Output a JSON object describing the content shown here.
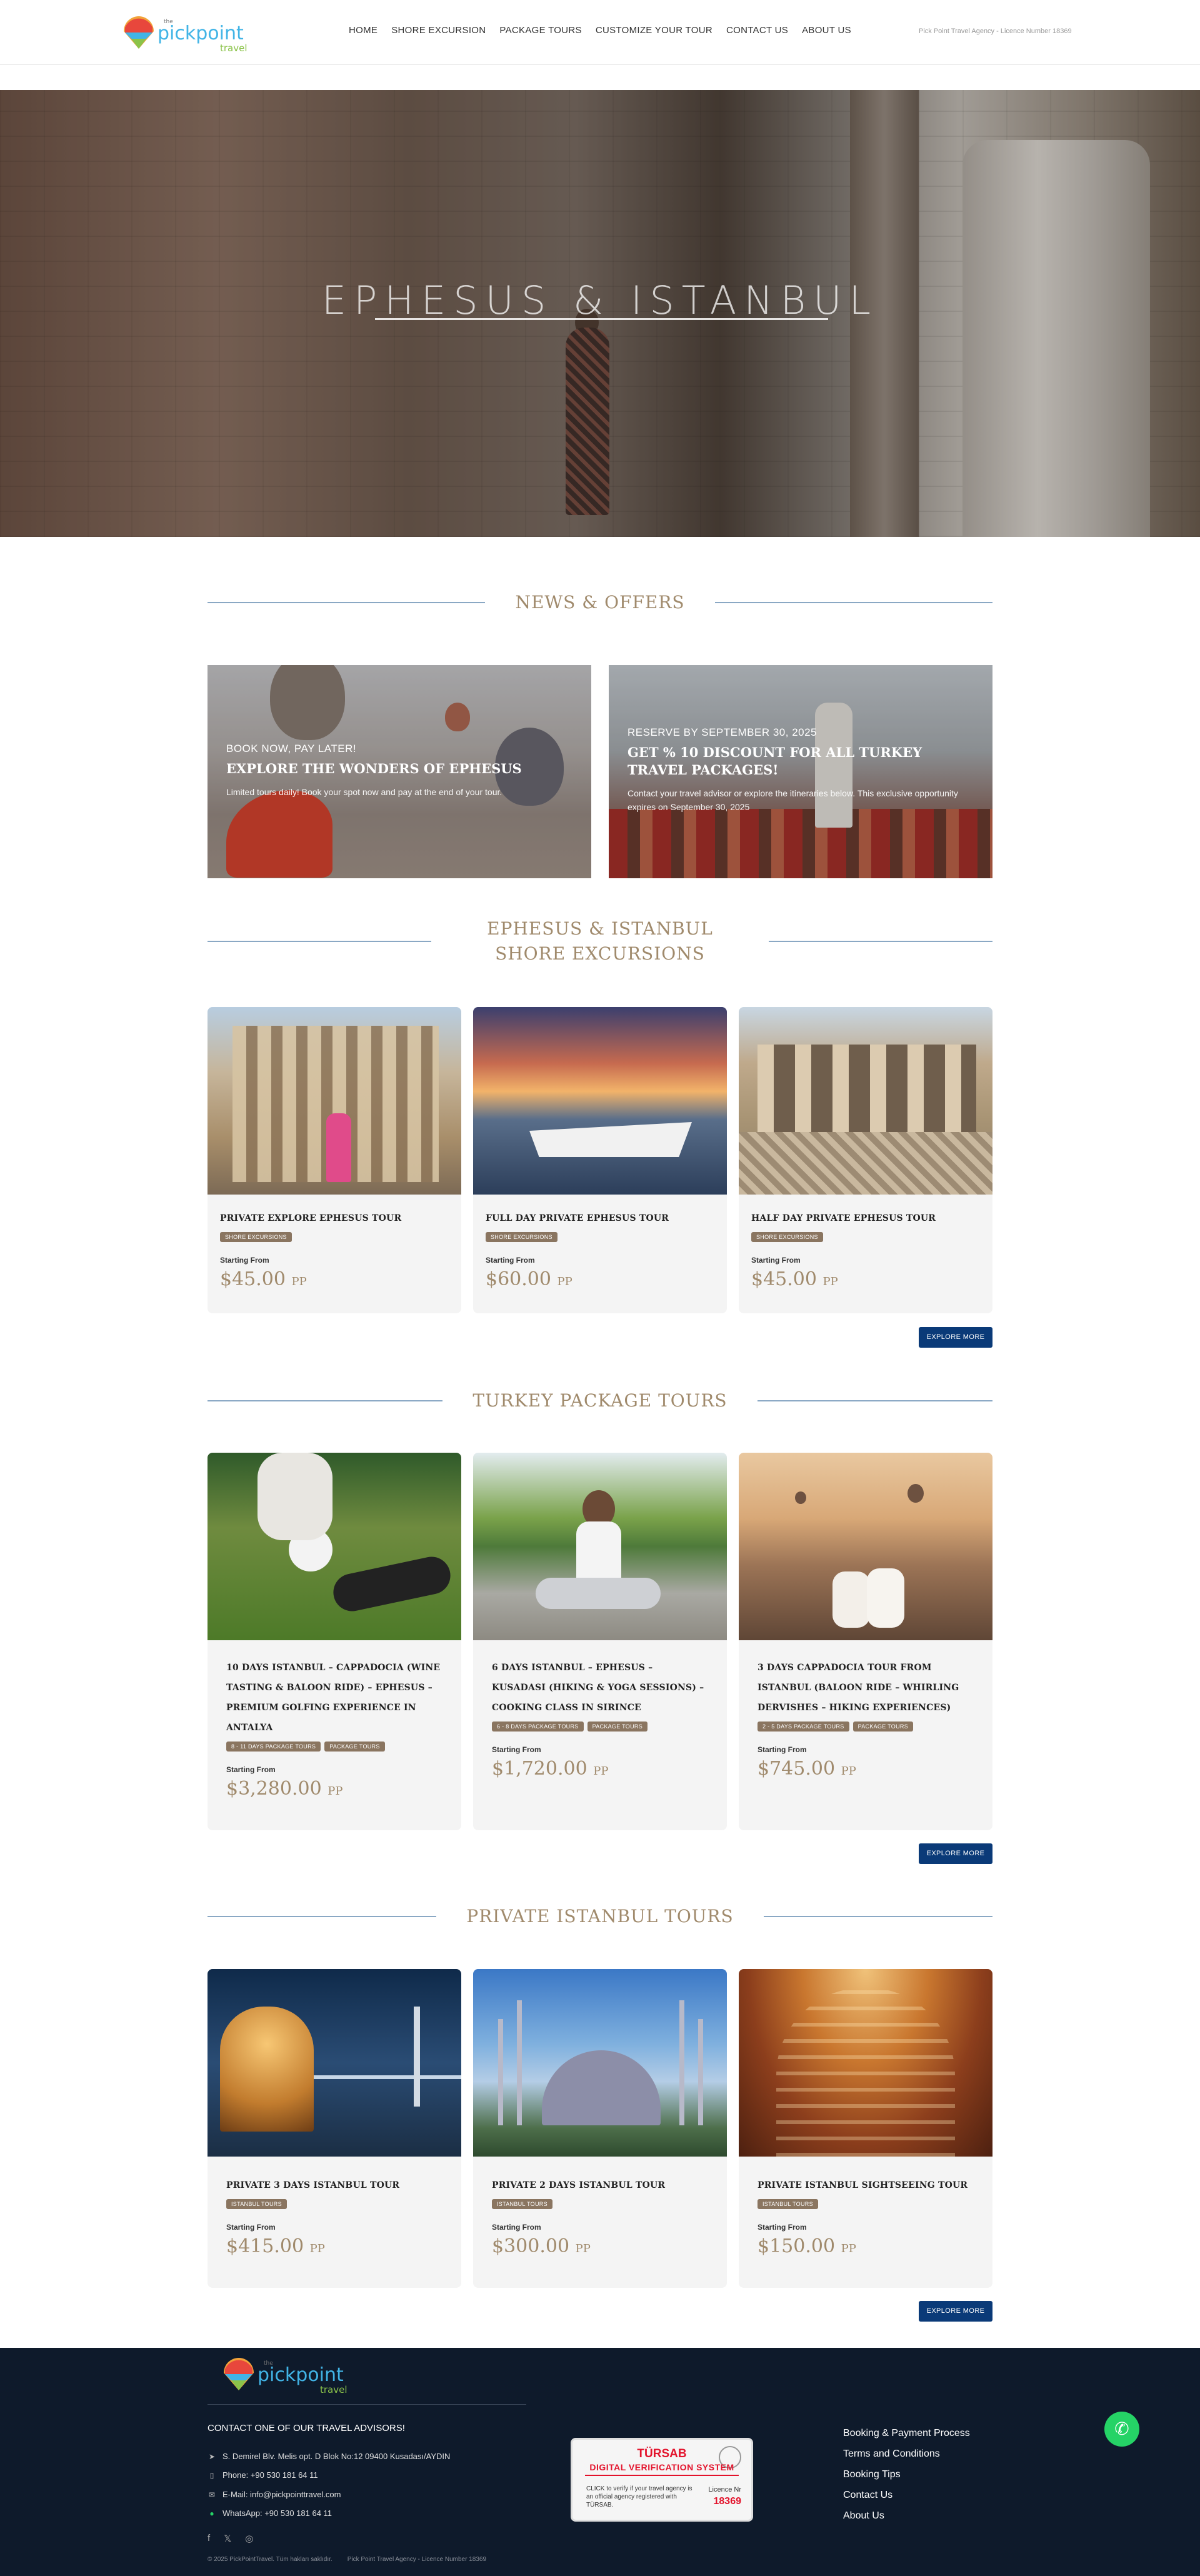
{
  "header": {
    "logo_pre": "the",
    "logo_main": "pickpoint",
    "logo_sub": "travel",
    "nav": [
      "HOME",
      "SHORE EXCURSION",
      "PACKAGE TOURS",
      "CUSTOMIZE YOUR TOUR",
      "CONTACT US",
      "ABOUT US"
    ],
    "licence": "Pick Point Travel Agency - Licence Number 18369"
  },
  "hero": {
    "title": "EPHESUS & ISTANBUL"
  },
  "news": {
    "heading": "NEWS & OFFERS",
    "offers": [
      {
        "small": "BOOK NOW, PAY LATER!",
        "big": "EXPLORE THE WONDERS OF EPHESUS",
        "desc": "Limited tours daily! Book your spot now and pay at the end of your tour."
      },
      {
        "small": "RESERVE BY SEPTEMBER 30, 2025",
        "big": "GET % 10 DISCOUNT FOR ALL TURKEY TRAVEL PACKAGES!",
        "desc": "Contact your travel advisor or explore the itineraries below. This exclusive opportunity expires on September 30, 2025"
      }
    ]
  },
  "shore": {
    "heading": "EPHESUS & ISTANBUL SHORE EXCURSIONS",
    "cards": [
      {
        "title": "PRIVATE EXPLORE EPHESUS TOUR",
        "badges": [
          "SHORE EXCURSIONS"
        ],
        "from": "Starting From",
        "price": "$45.00",
        "pp": "PP"
      },
      {
        "title": "FULL DAY PRIVATE EPHESUS TOUR",
        "badges": [
          "SHORE EXCURSIONS"
        ],
        "from": "Starting From",
        "price": "$60.00",
        "pp": "PP"
      },
      {
        "title": "HALF DAY PRIVATE EPHESUS TOUR",
        "badges": [
          "SHORE EXCURSIONS"
        ],
        "from": "Starting From",
        "price": "$45.00",
        "pp": "PP"
      }
    ],
    "button": "EXPLORE MORE"
  },
  "package": {
    "heading": "TURKEY PACKAGE TOURS",
    "cards": [
      {
        "title": "10 DAYS ISTANBUL – CAPPADOCIA (WINE TASTING & BALOON RIDE) – EPHESUS – PREMIUM GOLFING EXPERIENCE IN ANTALYA",
        "badges": [
          "8 - 11 DAYS PACKAGE TOURS",
          "PACKAGE TOURS"
        ],
        "from": "Starting From",
        "price": "$3,280.00",
        "pp": "PP"
      },
      {
        "title": "6 DAYS ISTANBUL – EPHESUS – KUSADASI (HIKING & YOGA SESSIONS) – COOKING CLASS IN SIRINCE",
        "badges": [
          "6 - 8 DAYS PACKAGE TOURS",
          "PACKAGE TOURS"
        ],
        "from": "Starting From",
        "price": "$1,720.00",
        "pp": "PP"
      },
      {
        "title": "3 DAYS CAPPADOCIA TOUR FROM ISTANBUL (BALOON RIDE – WHIRLING DERVISHES – HIKING EXPERIENCES)",
        "badges": [
          "2 - 5 DAYS PACKAGE TOURS",
          "PACKAGE TOURS"
        ],
        "from": "Starting From",
        "price": "$745.00",
        "pp": "PP"
      }
    ],
    "button": "EXPLORE MORE"
  },
  "istanbul": {
    "heading": "PRIVATE ISTANBUL TOURS",
    "cards": [
      {
        "title": "PRIVATE 3 DAYS ISTANBUL TOUR",
        "badges": [
          "ISTANBUL TOURS"
        ],
        "from": "Starting From",
        "price": "$415.00",
        "pp": "PP"
      },
      {
        "title": "PRIVATE 2 DAYS ISTANBUL TOUR",
        "badges": [
          "ISTANBUL TOURS"
        ],
        "from": "Starting From",
        "price": "$300.00",
        "pp": "PP"
      },
      {
        "title": "PRIVATE ISTANBUL SIGHTSEEING TOUR",
        "badges": [
          "ISTANBUL TOURS"
        ],
        "from": "Starting From",
        "price": "$150.00",
        "pp": "PP"
      }
    ],
    "button": "EXPLORE MORE"
  },
  "footer": {
    "contact_title": "CONTACT ONE OF OUR TRAVEL ADVISORS!",
    "address": "S. Demirel Blv. Melis opt. D Blok No:12 09400 Kusadası/AYDIN",
    "phone": "Phone: +90 530 181 64 11",
    "email": "E-Mail: info@pickpointtravel.com",
    "whatsapp": "WhatsApp: +90 530 181 64 11",
    "copyright": "© 2025 PickPointTravel. Tüm hakları saklıdır.",
    "licence": "Pick Point Travel Agency - Licence Number 18369",
    "tursab": {
      "name": "TÜRSAB",
      "system": "DIGITAL VERIFICATION SYSTEM",
      "text": "CLICK to verify if your travel agency is an official agency registered with TÜRSAB.",
      "licence_label": "Licence Nr",
      "licence_no": "18369"
    },
    "links": [
      "Booking & Payment Process",
      "Terms and Conditions",
      "Booking Tips",
      "Contact Us",
      "About Us"
    ]
  },
  "colors": {
    "accent": "#a08a6c",
    "navy": "#0a3a78",
    "footer_bg": "#0e1a2b",
    "whatsapp": "#25d366"
  }
}
